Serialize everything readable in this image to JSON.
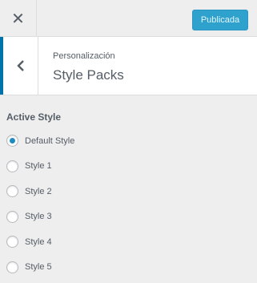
{
  "header": {
    "close_icon": "close-icon",
    "publish_label": "Publicada"
  },
  "section": {
    "back_icon": "chevron-left-icon",
    "breadcrumb": "Personalización",
    "title": "Style Packs"
  },
  "control": {
    "label": "Active Style",
    "options": [
      {
        "label": "Default Style",
        "checked": true
      },
      {
        "label": "Style 1",
        "checked": false
      },
      {
        "label": "Style 2",
        "checked": false
      },
      {
        "label": "Style 3",
        "checked": false
      },
      {
        "label": "Style 4",
        "checked": false
      },
      {
        "label": "Style 5",
        "checked": false
      }
    ]
  },
  "colors": {
    "accent": "#0073aa",
    "publish_bg": "#2ea2cc",
    "radio_dot": "#1e8cbe",
    "background": "#eeeeee"
  }
}
